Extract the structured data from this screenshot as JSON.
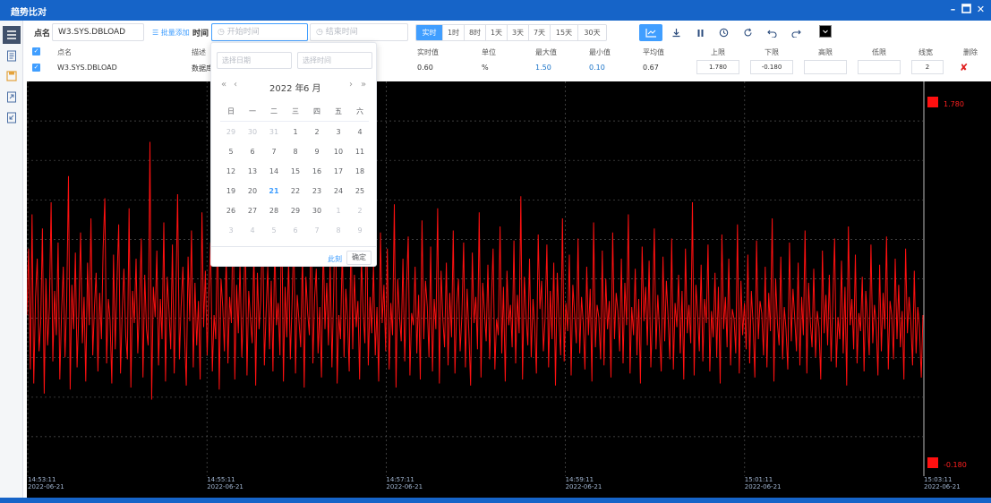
{
  "window": {
    "title": "趋势比对"
  },
  "toolbar": {
    "point_label": "点名",
    "point_value": "W3.SYS.DBLOAD",
    "batch_add": "批量添加",
    "time_label": "时间",
    "start_placeholder": "开始时间",
    "end_placeholder": "结束时间",
    "ranges": [
      "实时",
      "1时",
      "8时",
      "1天",
      "3天",
      "7天",
      "15天",
      "30天"
    ],
    "active_range": "实时",
    "line_color": "#000000"
  },
  "table": {
    "headers": [
      "点名",
      "描述",
      "实时值",
      "单位",
      "最大值",
      "最小值",
      "平均值",
      "上限",
      "下限",
      "高限",
      "低限",
      "线宽",
      "删除"
    ],
    "row": {
      "name": "W3.SYS.DBLOAD",
      "desc": "数据库",
      "realtime": "0.60",
      "unit": "%",
      "max": "1.50",
      "min": "0.10",
      "avg": "0.67",
      "upper": "1.780",
      "lower": "-0.180",
      "high": "",
      "low": "",
      "width": "2",
      "delete_icon": "✘"
    }
  },
  "picker": {
    "date_placeholder": "选择日期",
    "time_placeholder": "选择时间",
    "year": "2022 年",
    "month": "6 月",
    "weekdays": [
      "日",
      "一",
      "二",
      "三",
      "四",
      "五",
      "六"
    ],
    "weeks": [
      [
        "29",
        "30",
        "31",
        "1",
        "2",
        "3",
        "4"
      ],
      [
        "5",
        "6",
        "7",
        "8",
        "9",
        "10",
        "11"
      ],
      [
        "12",
        "13",
        "14",
        "15",
        "16",
        "17",
        "18"
      ],
      [
        "19",
        "20",
        "21",
        "22",
        "23",
        "24",
        "25"
      ],
      [
        "26",
        "27",
        "28",
        "29",
        "30",
        "1",
        "2"
      ],
      [
        "3",
        "4",
        "5",
        "6",
        "7",
        "8",
        "9"
      ]
    ],
    "today": "21",
    "now_label": "此刻",
    "ok_label": "确定"
  },
  "chart_data": {
    "type": "line",
    "series": [
      {
        "color": "#ff1010",
        "values": [
          0.62,
          0.95,
          0.35,
          1.12,
          0.28,
          0.71,
          0.9,
          0.44,
          0.58,
          1.05,
          0.23,
          0.8,
          0.47,
          0.66,
          1.18,
          0.39,
          0.74,
          0.52,
          0.98,
          0.3,
          0.62,
          0.86,
          0.41,
          0.69,
          1.31,
          0.25,
          0.77,
          0.55,
          0.93,
          0.36,
          0.64,
          1.03,
          0.48,
          0.71,
          0.29,
          0.88,
          0.57,
          1.1,
          0.42,
          0.66,
          0.83,
          0.34,
          0.73,
          0.5,
          0.95,
          1.2,
          0.38,
          0.7,
          0.6,
          0.28,
          0.92,
          0.45,
          0.79,
          1.07,
          0.33,
          0.63,
          0.85,
          0.52,
          0.4,
          1.15,
          0.26,
          0.74,
          0.58,
          0.9,
          0.43,
          0.68,
          1.0,
          0.31,
          0.82,
          0.55,
          0.47,
          1.48,
          0.2,
          0.76,
          0.61,
          0.94,
          0.37,
          0.7,
          0.5,
          1.08,
          0.29,
          0.81,
          0.64,
          0.45,
          0.97,
          0.33,
          0.72,
          1.22,
          0.4,
          0.66,
          0.86,
          0.52,
          0.27,
          0.91,
          0.59,
          1.04,
          0.36,
          0.78,
          0.47,
          0.69,
          0.3,
          1.13,
          0.56,
          0.84,
          0.42,
          0.73,
          0.98,
          0.34,
          0.62,
          0.5,
          1.09,
          0.25,
          0.8,
          0.66,
          0.44,
          0.93,
          0.38,
          0.71,
          0.58,
          1.16,
          0.3,
          0.77,
          0.53,
          0.88,
          0.41,
          0.65,
          1.02,
          0.32,
          0.74,
          0.6,
          0.48,
          0.96,
          0.27,
          0.83,
          0.55,
          0.7,
          1.11,
          0.37,
          0.63,
          0.86,
          0.45,
          0.79,
          0.34,
          0.99,
          0.57,
          0.68,
          0.42,
          1.19,
          0.29,
          0.76,
          0.51,
          0.9,
          0.4,
          0.67,
          1.05,
          0.33,
          0.72,
          0.59,
          0.46,
          0.94,
          0.26,
          0.81,
          0.63,
          0.52,
          1.14,
          0.38,
          0.7,
          0.85,
          0.43,
          0.66,
          0.31,
          1.0,
          0.55,
          0.78,
          0.47,
          0.89,
          0.36,
          0.73,
          1.24,
          0.28,
          0.62,
          0.5,
          0.97,
          0.41,
          0.75,
          0.6,
          0.34,
          1.07,
          0.45,
          0.82,
          0.56,
          0.69,
          0.3,
          0.92,
          0.64,
          0.48,
          1.12,
          0.37,
          0.71,
          0.53,
          0.87,
          0.42,
          0.66,
          0.29,
          1.03,
          0.58,
          0.77,
          0.44,
          0.95,
          0.35,
          0.68,
          0.52,
          1.17,
          0.26,
          0.8,
          0.61,
          0.49,
          0.9,
          0.39,
          0.74,
          1.01,
          0.32,
          0.63,
          0.57,
          0.86,
          0.43,
          0.72,
          0.3,
          1.09,
          0.5,
          0.79,
          0.66,
          0.41,
          0.96,
          0.34,
          0.7,
          0.55,
          1.15,
          0.28,
          0.84,
          0.6,
          0.46,
          0.88,
          0.37,
          0.73,
          0.51,
          1.04,
          0.33,
          0.67,
          0.8,
          0.44,
          0.62,
          0.98,
          0.36,
          0.75,
          0.54,
          0.27,
          0.93,
          0.58,
          0.71,
          0.45,
          1.13,
          0.31,
          0.78,
          0.64,
          0.49,
          0.87,
          0.4,
          0.69,
          0.95,
          0.35,
          0.6,
          0.52,
          1.06,
          0.43,
          0.76,
          0.29,
          0.84,
          0.57,
          0.67,
          0.46,
          0.99,
          0.38,
          0.72,
          0.53,
          1.21,
          0.3,
          0.81,
          0.62,
          0.47,
          0.9,
          0.41,
          0.7,
          0.56,
          0.33,
          1.02,
          0.65,
          0.79,
          0.44,
          0.6,
          0.97,
          0.36,
          0.74,
          0.5,
          0.88,
          0.27,
          0.83,
          0.59,
          0.42,
          1.1,
          0.39,
          0.68,
          0.54,
          0.92,
          0.32,
          0.77,
          0.63,
          0.48,
          1.0,
          0.43,
          0.71,
          0.58,
          0.35,
          0.86,
          0.52,
          0.75,
          0.29,
          1.08,
          0.46,
          0.67,
          0.61,
          0.4,
          0.94,
          0.37,
          0.8,
          0.55,
          0.69,
          0.31,
          1.03,
          0.5,
          0.73,
          0.64,
          0.44,
          0.9,
          0.38,
          0.78,
          0.57,
          1.12,
          0.33,
          0.66,
          0.52,
          0.85,
          0.42,
          0.7,
          0.28,
          0.96,
          0.59,
          0.76,
          0.47,
          0.89,
          0.36,
          0.63,
          1.05,
          0.45,
          0.72,
          0.54,
          0.34,
          0.91,
          0.49,
          0.79,
          0.6,
          0.4,
          1.0,
          0.35,
          0.68,
          0.56,
          0.82,
          0.43,
          0.74,
          0.3,
          0.95,
          0.53,
          0.67,
          0.48,
          1.18,
          0.32,
          0.77,
          0.62,
          0.44,
          0.87,
          0.39,
          0.7,
          0.58,
          0.97,
          0.34,
          0.64,
          0.51,
          0.83,
          0.41,
          0.76,
          0.28,
          1.02,
          0.55,
          0.71,
          0.46,
          0.9,
          0.37,
          0.65,
          0.6,
          0.43,
          1.07,
          0.33,
          0.79,
          0.52,
          0.68,
          0.45,
          0.92,
          0.38,
          0.74,
          0.57,
          0.31,
          0.99,
          0.5,
          0.69,
          0.63,
          0.42,
          0.86,
          0.36,
          0.73,
          0.54,
          1.1,
          0.29,
          0.8,
          0.58,
          0.47,
          0.91,
          0.4,
          0.66,
          0.55,
          0.35,
          0.98,
          0.49,
          0.75,
          0.61,
          0.44,
          0.88,
          0.37,
          0.71,
          0.52,
          1.04,
          0.33,
          0.78,
          0.59,
          0.46,
          0.85,
          0.41,
          0.64,
          0.56,
          0.3,
          0.94,
          0.53,
          0.72,
          0.47,
          0.82,
          0.39,
          0.68,
          1.0,
          0.36,
          0.61,
          0.5,
          0.89,
          0.43,
          0.76,
          0.27,
          1.06,
          0.57,
          0.7,
          0.45,
          0.92,
          0.38,
          0.63,
          0.54,
          0.81,
          0.34,
          0.74,
          0.6,
          0.42,
          0.97,
          0.48,
          0.67,
          0.58,
          0.32,
          0.87,
          0.44,
          0.73,
          0.55,
          1.01,
          0.35,
          0.69,
          0.62,
          0.4,
          0.9,
          0.5,
          0.77,
          0.46,
          0.64,
          0.3,
          0.95,
          0.53,
          0.71,
          0.59,
          0.37,
          0.84,
          0.43,
          0.66,
          0.56,
          0.31,
          0.62
        ]
      }
    ],
    "x_ticks": [
      {
        "time": "14:53:11",
        "date": "2022-06-21"
      },
      {
        "time": "14:55:11",
        "date": "2022-06-21"
      },
      {
        "time": "14:57:11",
        "date": "2022-06-21"
      },
      {
        "time": "14:59:11",
        "date": "2022-06-21"
      },
      {
        "time": "15:01:11",
        "date": "2022-06-21"
      },
      {
        "time": "15:03:11",
        "date": "2022-06-21"
      }
    ],
    "ylim": [
      -0.18,
      1.78
    ],
    "upper_limit_label": "1.780",
    "lower_limit_label": "-0.180",
    "grid": true,
    "background": "#000000"
  }
}
